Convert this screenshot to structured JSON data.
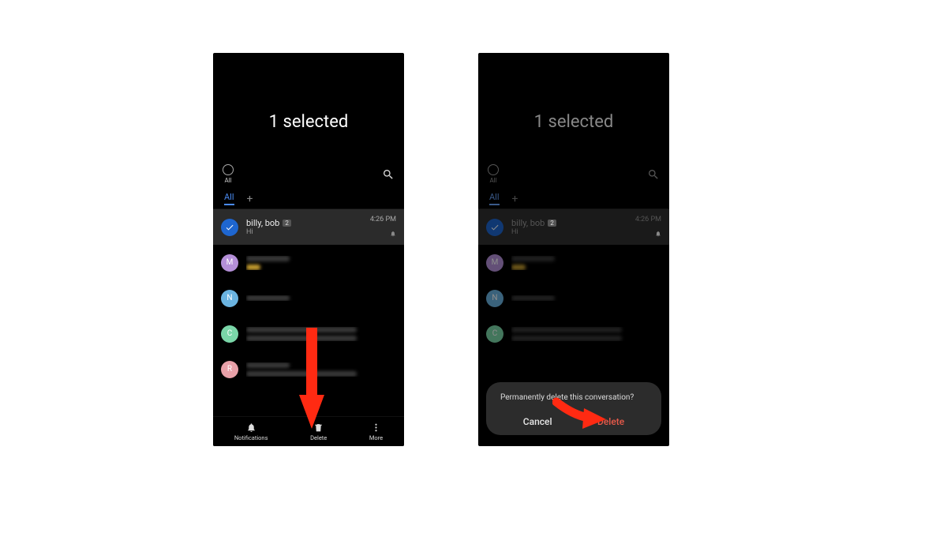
{
  "left": {
    "selection_title": "1 selected",
    "all_label": "All",
    "tab_all": "All",
    "tab_add": "+",
    "conv": {
      "name": "billy, bob",
      "badge": "2",
      "preview": "Hi",
      "time": "4:26 PM"
    },
    "avatars": {
      "m": "M",
      "n": "N",
      "c": "C",
      "r": "R"
    },
    "bottombar": {
      "notifications": "Notifications",
      "delete": "Delete",
      "more": "More"
    }
  },
  "right": {
    "selection_title": "1 selected",
    "all_label": "All",
    "tab_all": "All",
    "tab_add": "+",
    "conv": {
      "name": "billy, bob",
      "badge": "2",
      "preview": "Hi",
      "time": "4:26 PM"
    },
    "avatars": {
      "m": "M",
      "n": "N",
      "c": "C",
      "r": "R"
    },
    "dialog": {
      "message": "Permanently delete this conversation?",
      "cancel": "Cancel",
      "delete": "Delete"
    }
  },
  "colors": {
    "accent_blue": "#1e66d0",
    "danger_red": "#e85a4a",
    "arrow_red": "#ff2a12"
  }
}
